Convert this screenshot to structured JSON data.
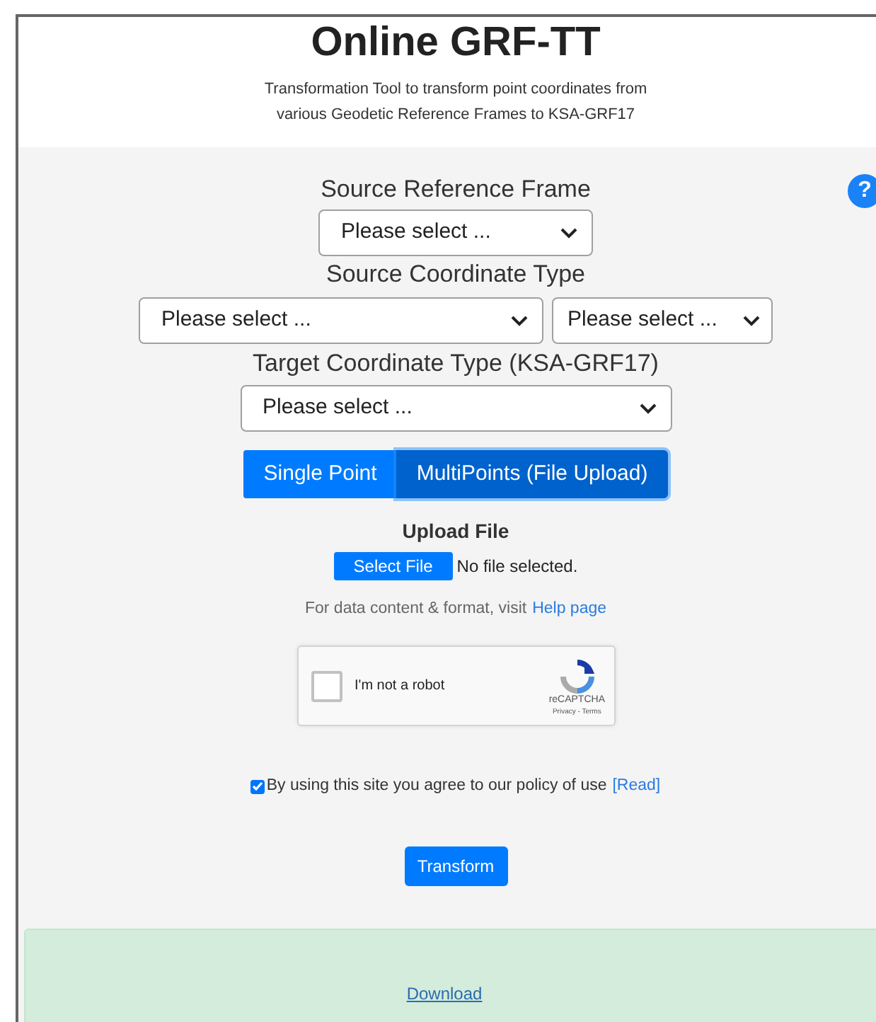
{
  "header": {
    "title": "Online GRF-TT",
    "subtitle_lines": [
      "Transformation Tool to transform point coordinates from",
      "various Geodetic Reference Frames to KSA-GRF17"
    ]
  },
  "help_button": {
    "label": "?"
  },
  "source_reference_frame": {
    "label": "Source Reference Frame",
    "value": "Please select ..."
  },
  "source_coordinate_type": {
    "label": "Source Coordinate Type",
    "values": [
      "Please select ...",
      "Please select ..."
    ]
  },
  "target_coordinate_type": {
    "label": "Target Coordinate Type (KSA-GRF17)",
    "value": "Please select ..."
  },
  "mode_tabs": [
    {
      "label": "Single Point",
      "selected": false
    },
    {
      "label": "MultiPoints (File Upload)",
      "selected": true
    }
  ],
  "upload": {
    "title": "Upload File",
    "button": "Select File",
    "status": "No file selected.",
    "help_text": "For data content & format, visit",
    "help_link": "Help page"
  },
  "captcha": {
    "label": "I'm not a robot",
    "checked": false,
    "brand": "reCAPTCHA",
    "links": "Privacy - Terms"
  },
  "policy": {
    "checked": true,
    "text": "By using this site you agree to our policy of use",
    "link": "[Read]"
  },
  "transform_button": "Transform",
  "result": {
    "link": "Download"
  }
}
